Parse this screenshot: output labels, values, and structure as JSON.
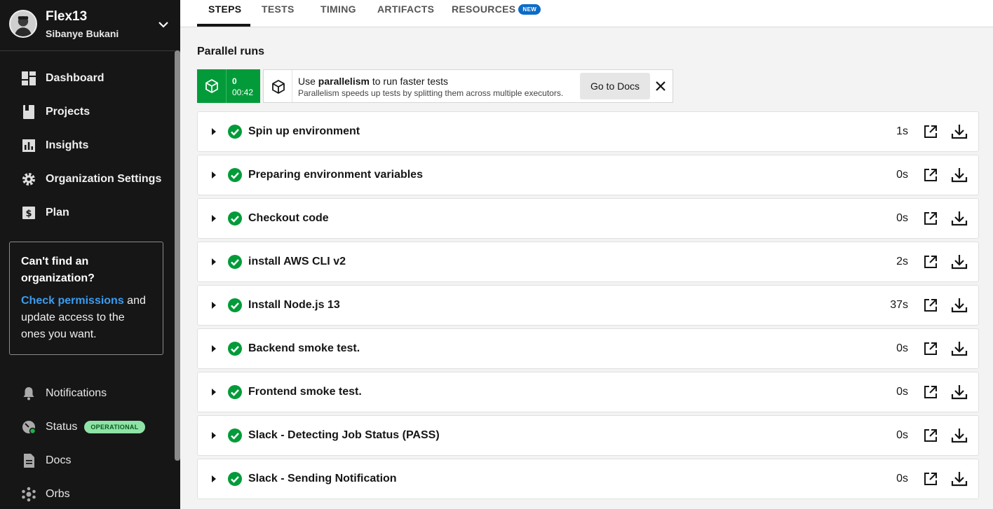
{
  "sidebar": {
    "org_name": "Flex13",
    "org_user": "Sibanye Bukani",
    "items": [
      {
        "label": "Dashboard",
        "icon": "dashboard-icon"
      },
      {
        "label": "Projects",
        "icon": "projects-icon"
      },
      {
        "label": "Insights",
        "icon": "insights-icon"
      },
      {
        "label": "Organization Settings",
        "icon": "gear-icon"
      },
      {
        "label": "Plan",
        "icon": "dollar-icon"
      }
    ],
    "help": {
      "title": "Can't find an organization?",
      "link": "Check permissions",
      "text": " and update access to the ones you want."
    },
    "bottom_items": [
      {
        "label": "Notifications",
        "icon": "bell-icon"
      },
      {
        "label": "Status",
        "icon": "status-icon",
        "badge": "OPERATIONAL"
      },
      {
        "label": "Docs",
        "icon": "docs-icon"
      },
      {
        "label": "Orbs",
        "icon": "orbs-icon"
      }
    ]
  },
  "tabs": [
    {
      "label": "STEPS",
      "active": true
    },
    {
      "label": "TESTS"
    },
    {
      "label": "TIMING"
    },
    {
      "label": "ARTIFACTS"
    },
    {
      "label": "RESOURCES",
      "badge": "NEW"
    }
  ],
  "parallel": {
    "title": "Parallel runs",
    "run_index": "0",
    "run_time": "00:42",
    "banner_title_plain": "Use ",
    "banner_title_bold": "parallelism",
    "banner_title_rest": " to run faster tests",
    "banner_text": "Parallelism speeds up tests by splitting them across multiple executors.",
    "docs_button": "Go to Docs"
  },
  "steps": [
    {
      "name": "Spin up environment",
      "duration": "1s"
    },
    {
      "name": "Preparing environment variables",
      "duration": "0s"
    },
    {
      "name": "Checkout code",
      "duration": "0s"
    },
    {
      "name": "install AWS CLI v2",
      "duration": "2s"
    },
    {
      "name": "Install Node.js 13",
      "duration": "37s"
    },
    {
      "name": "Backend smoke test.",
      "duration": "0s"
    },
    {
      "name": "Frontend smoke test.",
      "duration": "0s"
    },
    {
      "name": "Slack - Detecting Job Status (PASS)",
      "duration": "0s"
    },
    {
      "name": "Slack - Sending Notification",
      "duration": "0s"
    }
  ],
  "colors": {
    "sidebar_bg": "#161616",
    "success": "#039b3a",
    "link": "#3b9cf0",
    "new_badge": "#0b6cc7",
    "status_badge": "#8fe3a6"
  }
}
